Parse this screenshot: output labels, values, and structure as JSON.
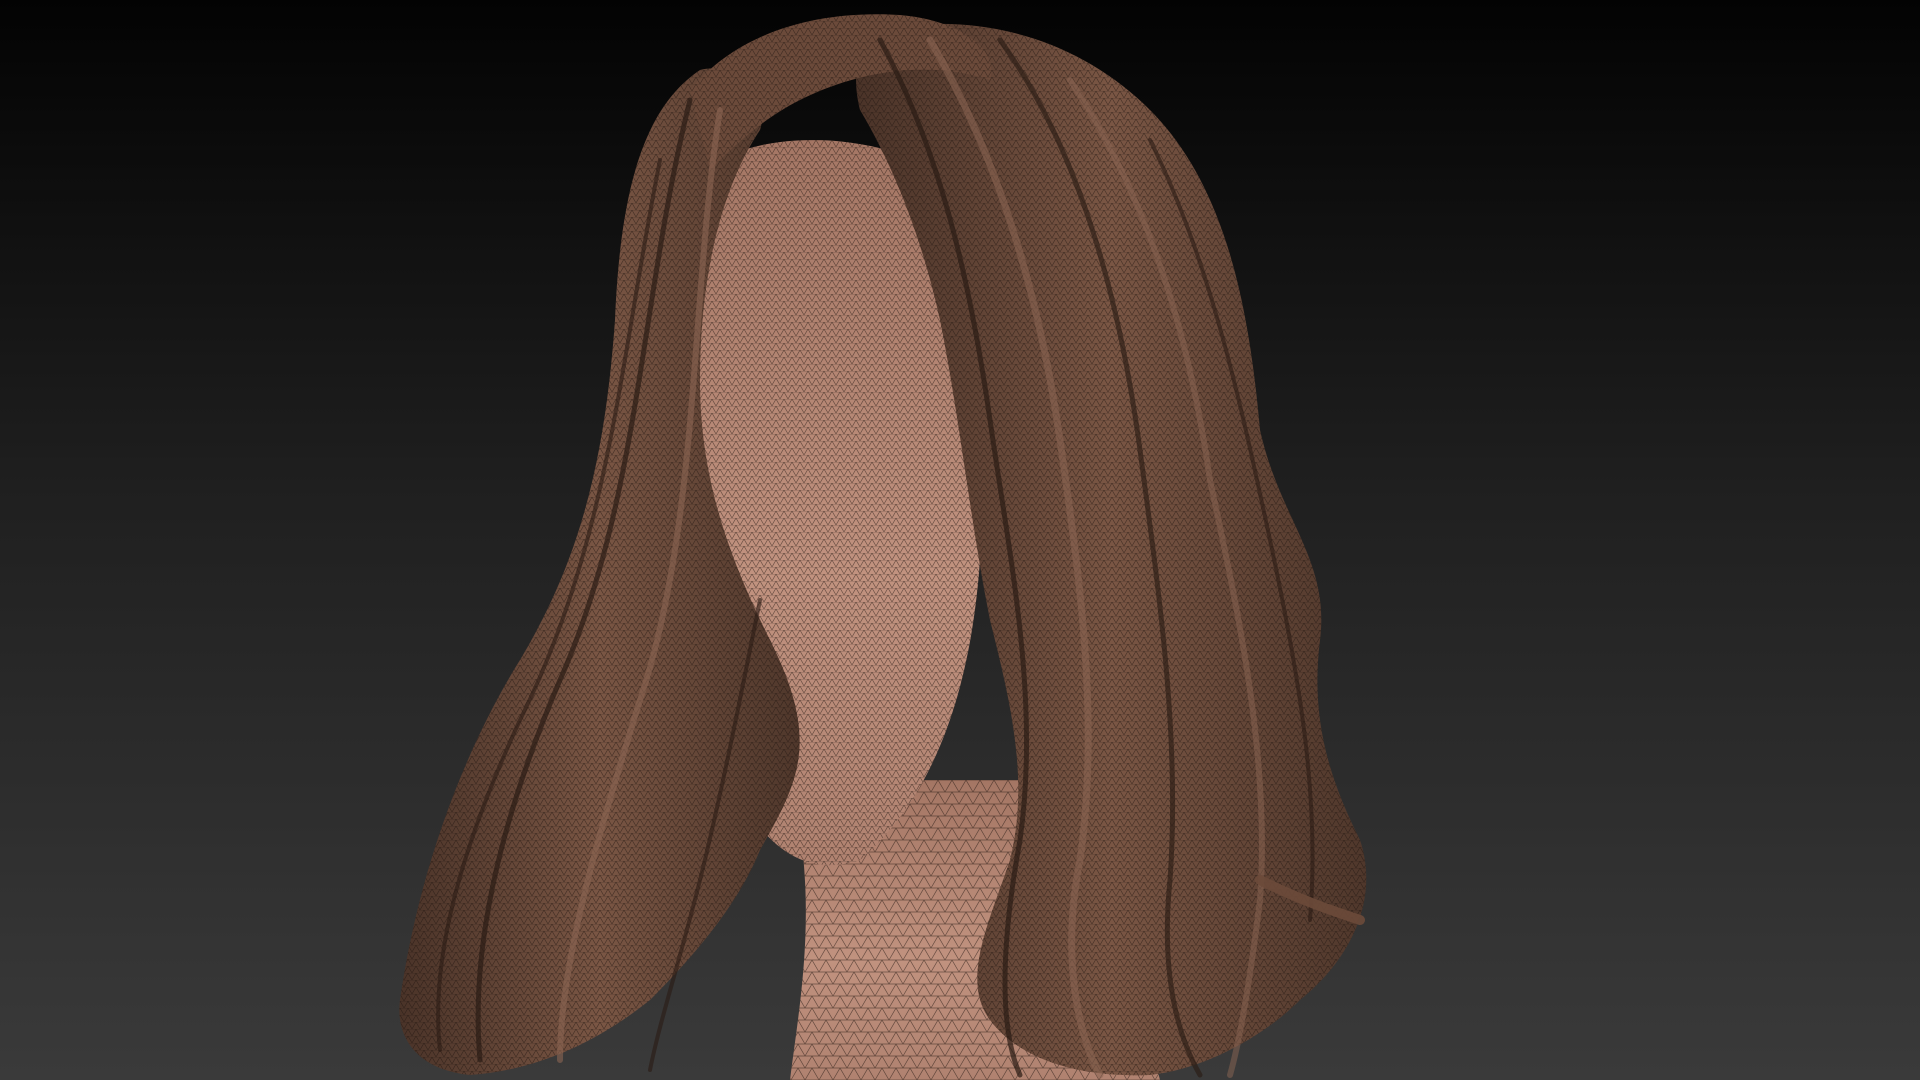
{
  "viewport": {
    "background_top": "#030303",
    "background_bottom": "#3a3a3a"
  },
  "model": {
    "icon": "wireframe-hair-mesh-icon",
    "skin_color": "#b98a76",
    "hair_color": "#6b4a3a",
    "hair_highlight": "#8c6654",
    "wire_color": "#1e140f",
    "display_mode": "polyframe"
  }
}
